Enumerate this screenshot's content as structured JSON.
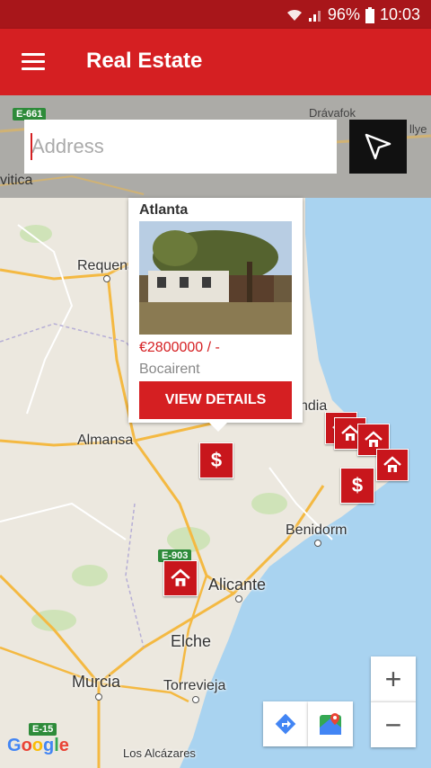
{
  "status_bar": {
    "battery": "96%",
    "time": "10:03",
    "wifi_icon": "wifi-icon",
    "signal_icon": "signal-icon",
    "battery_icon": "battery-icon"
  },
  "app_bar": {
    "title": "Real Estate",
    "menu_icon": "menu-icon"
  },
  "search": {
    "placeholder": "Address",
    "nav_icon": "navigation-icon"
  },
  "popup": {
    "title": "Atlanta",
    "price": "€2800000 / -",
    "location": "Bocairent",
    "button_label": "VIEW DETAILS"
  },
  "map": {
    "labels": [
      {
        "text": "Requena"
      },
      {
        "text": "Almansa"
      },
      {
        "text": "Benidorm"
      },
      {
        "text": "Alicante"
      },
      {
        "text": "Elche"
      },
      {
        "text": "Murcia"
      },
      {
        "text": "Torrevieja"
      },
      {
        "text": "Los Alcázares"
      },
      {
        "text": "Drávafok"
      },
      {
        "text": "vitica"
      },
      {
        "text": "ndia"
      },
      {
        "text": "llye"
      }
    ],
    "road_badges": [
      "E-661",
      "E-903",
      "E-15"
    ],
    "marker_symbols": {
      "price": "$",
      "house": "house-icon"
    },
    "zoom_in": "+",
    "zoom_out": "−",
    "directions_icon": "directions-icon",
    "maps_icon": "google-maps-icon",
    "attribution": "Google"
  },
  "colors": {
    "accent": "#d51f22",
    "status_bar": "#a8161a",
    "marker": "#c8161c",
    "water": "#a9d3f0"
  }
}
